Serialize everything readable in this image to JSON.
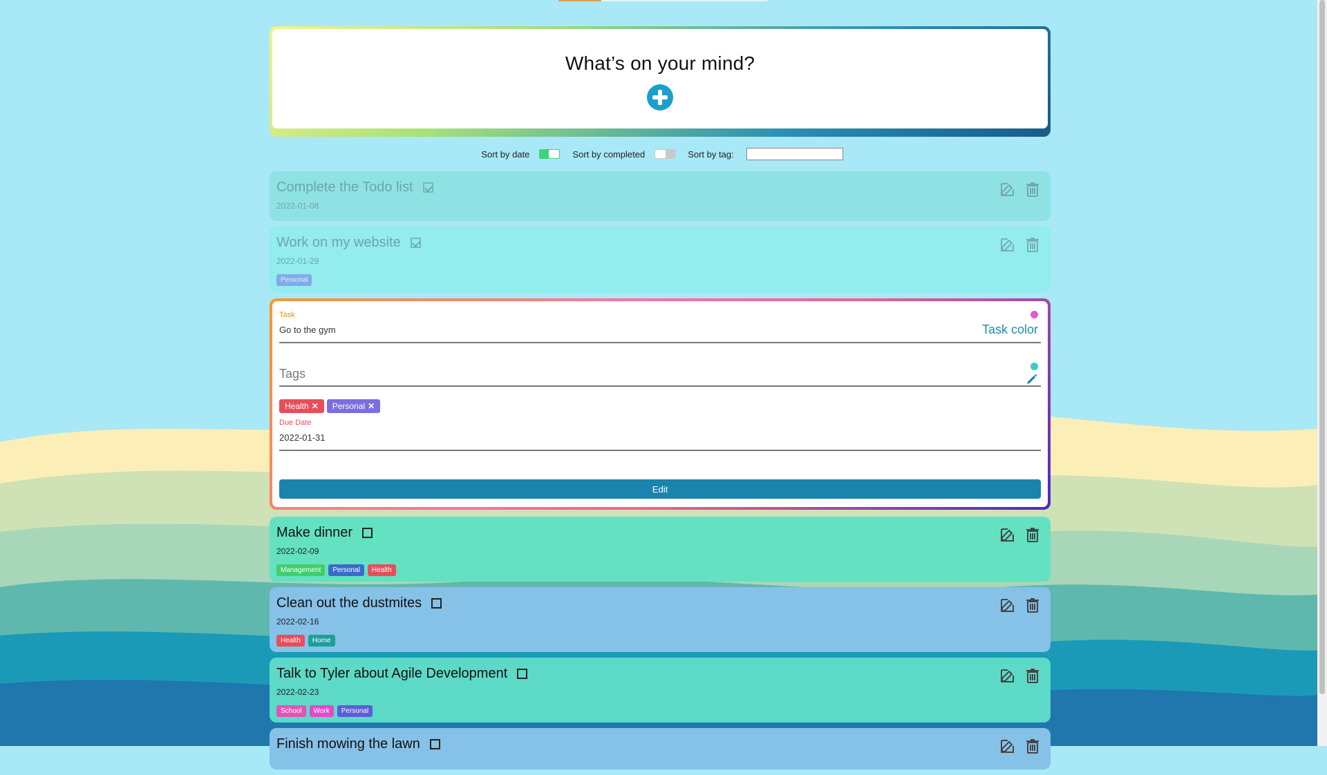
{
  "header": {
    "title": "What’s on your mind?"
  },
  "sort": {
    "by_date_label": "Sort by date",
    "by_completed_label": "Sort by completed",
    "by_tag_label": "Sort by tag:",
    "by_date_on": true,
    "by_completed_on": false,
    "tag_value": ""
  },
  "todos": [
    {
      "title": "Complete the Todo list",
      "date": "2022-01-08",
      "completed": true,
      "tags": []
    },
    {
      "title": "Work on my website",
      "date": "2022-01-29",
      "completed": true,
      "tags": [
        {
          "label": "Personal",
          "color": "#7a7ee8"
        }
      ]
    },
    {
      "title": "Make dinner",
      "date": "2022-02-09",
      "completed": false,
      "tags": [
        {
          "label": "Management",
          "color": "#3fcf6a"
        },
        {
          "label": "Personal",
          "color": "#3a6bc8"
        },
        {
          "label": "Health",
          "color": "#e84e5a"
        }
      ]
    },
    {
      "title": "Clean out the dustmites",
      "date": "2022-02-16",
      "completed": false,
      "tags": [
        {
          "label": "Health",
          "color": "#e84e5a"
        },
        {
          "label": "Home",
          "color": "#1e9e9a"
        }
      ]
    },
    {
      "title": "Talk to Tyler about Agile Development",
      "date": "2022-02-23",
      "completed": false,
      "tags": [
        {
          "label": "School",
          "color": "#e054b8"
        },
        {
          "label": "Work",
          "color": "#e04cc8"
        },
        {
          "label": "Personal",
          "color": "#5a5ed8"
        }
      ]
    },
    {
      "title": "Finish mowing the lawn",
      "date": "",
      "completed": false,
      "tags": []
    }
  ],
  "edit_form": {
    "task_label": "Task",
    "task_value": "Go to the gym",
    "task_color_label": "Task color",
    "tags_placeholder": "Tags",
    "chips": [
      {
        "label": "Health",
        "color": "#e84e5a"
      },
      {
        "label": "Personal",
        "color": "#7a6ee0"
      }
    ],
    "due_label": "Due Date",
    "due_value": "2022-01-31",
    "submit_label": "Edit"
  },
  "colors": {
    "card_completed_1": "#8ee2e4",
    "card_completed_2": "#93ecee",
    "card_green": "#63e1c1",
    "card_blue": "#86c1e8",
    "accent": "#1a84ad",
    "task_color_dot": "#e05cc8",
    "tag_color_dot": "#3fc7c7"
  },
  "icons": {
    "add": "plus-circle-icon",
    "edit": "edit-icon",
    "delete": "trash-icon",
    "pencil": "pencil-icon"
  }
}
